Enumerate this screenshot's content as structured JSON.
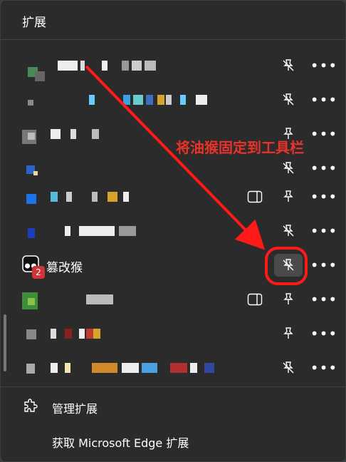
{
  "header": {
    "title": "扩展"
  },
  "extensions": [
    {
      "row": "ext-1",
      "pinned": false,
      "has_sidebar": false
    },
    {
      "row": "ext-2",
      "pinned": false,
      "has_sidebar": false
    },
    {
      "row": "ext-3",
      "pinned": true,
      "has_sidebar": false
    },
    {
      "row": "ext-4",
      "pinned": false,
      "has_sidebar": false
    },
    {
      "row": "ext-5",
      "pinned": true,
      "has_sidebar": true
    },
    {
      "row": "ext-6",
      "pinned": false,
      "has_sidebar": false
    },
    {
      "row": "tampermonkey",
      "name": "篡改猴",
      "badge": "2",
      "pinned": false,
      "has_sidebar": false
    },
    {
      "row": "ext-8",
      "pinned": true,
      "has_sidebar": true
    },
    {
      "row": "ext-9",
      "pinned": true,
      "has_sidebar": false
    },
    {
      "row": "ext-10",
      "pinned": false,
      "has_sidebar": false
    }
  ],
  "more_label": "•••",
  "footer": {
    "manage": "管理扩展",
    "get": "获取 Microsoft Edge 扩展"
  },
  "annotation": {
    "text": "将油猴固定到工具栏",
    "color": "#e8332a"
  },
  "colors": {
    "panel": "#2b2b2b",
    "accent_red": "#ff1a1a",
    "badge": "#d13438"
  },
  "icons": {
    "pin": "pin-icon",
    "unpin": "unpin-icon",
    "more": "more-icon",
    "sidebar": "sidebar-icon",
    "manage": "puzzle-icon"
  }
}
